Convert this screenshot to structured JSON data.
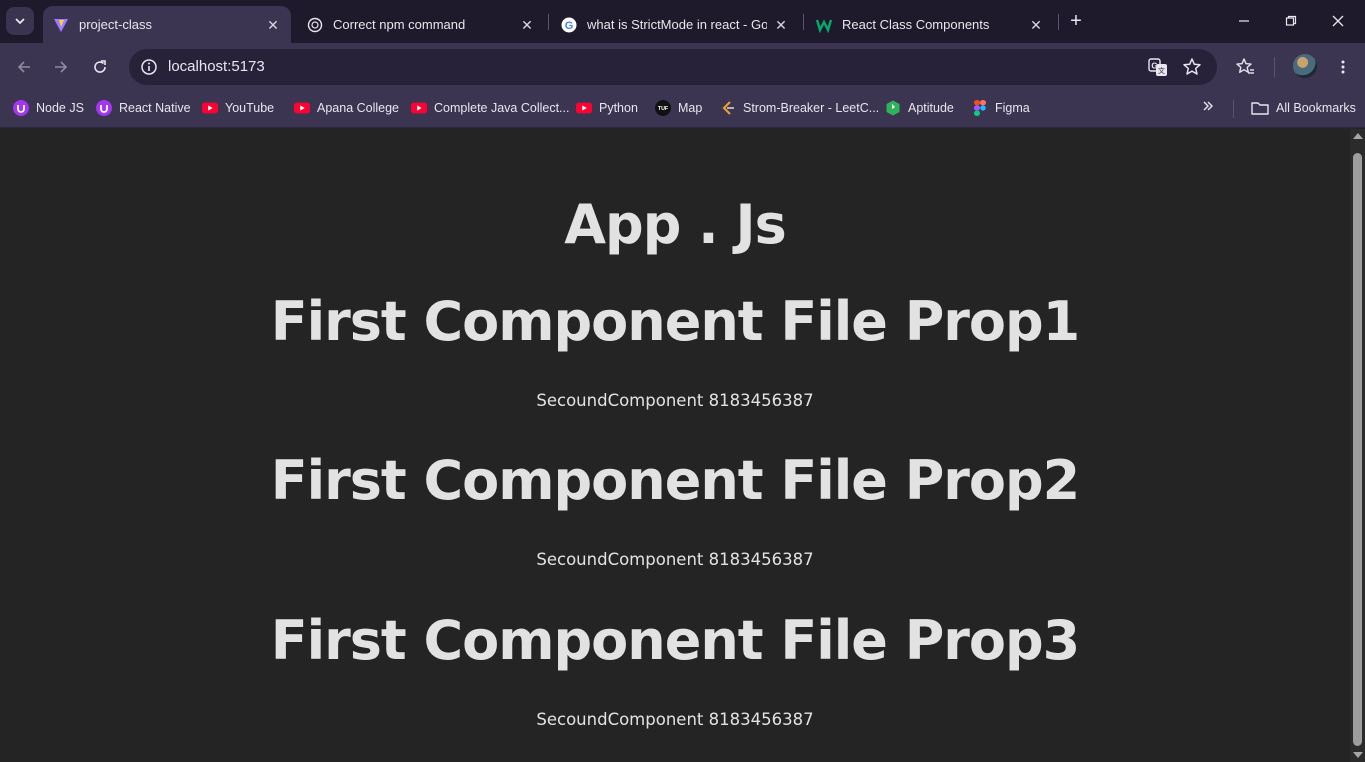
{
  "browser": {
    "tabs": [
      {
        "title": "project-class",
        "icon": "vite-icon",
        "active": true
      },
      {
        "title": "Correct npm command",
        "icon": "chatgpt-icon",
        "active": false
      },
      {
        "title": "what is StrictMode in react - Goog",
        "icon": "google-icon",
        "active": false
      },
      {
        "title": "React Class Components",
        "icon": "w3schools-icon",
        "active": false
      }
    ],
    "address": {
      "url": "localhost:5173"
    },
    "bookmarks": [
      {
        "label": "Node JS",
        "icon": "udemy-icon"
      },
      {
        "label": "React Native",
        "icon": "udemy-icon"
      },
      {
        "label": "YouTube",
        "icon": "youtube-icon"
      },
      {
        "label": "Apana College",
        "icon": "youtube-icon"
      },
      {
        "label": "Complete Java Collect...",
        "icon": "youtube-icon"
      },
      {
        "label": "Python",
        "icon": "youtube-icon"
      },
      {
        "label": "Map",
        "icon": "tuf-icon"
      },
      {
        "label": "Strom-Breaker - LeetC...",
        "icon": "leetcode-icon"
      },
      {
        "label": "Aptitude",
        "icon": "indiabix-icon"
      },
      {
        "label": "Figma",
        "icon": "figma-icon"
      }
    ],
    "all_bookmarks_label": "All Bookmarks",
    "colors": {
      "frame": "#1e1a2b",
      "toolbar": "#3b3552",
      "page_background": "#242424",
      "page_text": "#e0e0e0"
    }
  },
  "page": {
    "app_title": "App . Js",
    "sections": [
      {
        "heading": "First Component File Prop1",
        "text": "SecoundComponent 8183456387"
      },
      {
        "heading": "First Component File Prop2",
        "text": "SecoundComponent 8183456387"
      },
      {
        "heading": "First Component File Prop3",
        "text": "SecoundComponent 8183456387"
      }
    ]
  }
}
